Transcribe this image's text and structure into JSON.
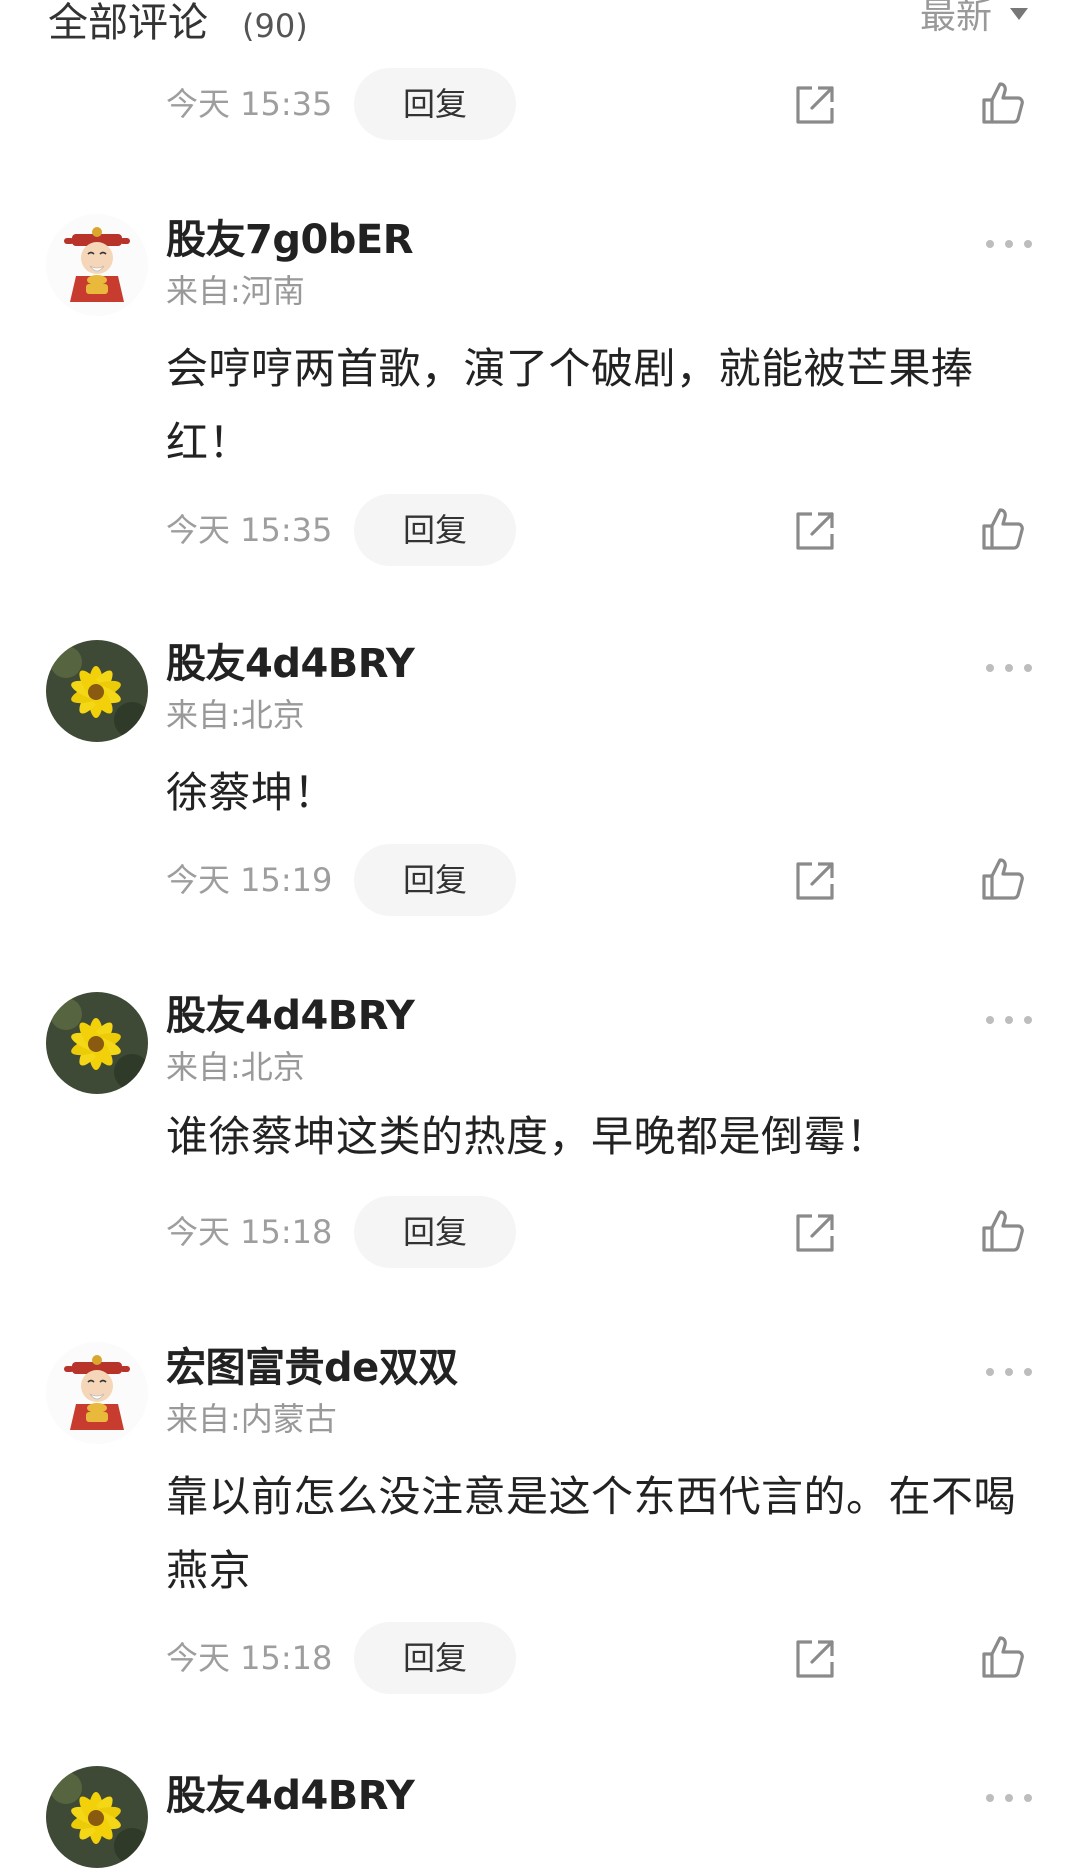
{
  "header": {
    "title": "全部评论",
    "count": "(90)",
    "sort_label": "最新"
  },
  "first_action": {
    "time": "今天 15:35",
    "reply_label": "回复"
  },
  "comments": [
    {
      "username": "股友7g0bER",
      "location": "来自:河南",
      "content": "会哼哼两首歌，演了个破剧，就能被芒果捧红！",
      "time": "今天 15:35",
      "reply_label": "回复",
      "avatar": "god-of-wealth-avatar"
    },
    {
      "username": "股友4d4BRY",
      "location": "来自:北京",
      "content": "徐蔡坤！",
      "time": "今天 15:19",
      "reply_label": "回复",
      "avatar": "yellow-flower-avatar"
    },
    {
      "username": "股友4d4BRY",
      "location": "来自:北京",
      "content": "谁徐蔡坤这类的热度，早晚都是倒霉！",
      "time": "今天 15:18",
      "reply_label": "回复",
      "avatar": "yellow-flower-avatar"
    },
    {
      "username": "宏图富贵de双双",
      "location": "来自:内蒙古",
      "content": "靠以前怎么没注意是这个东西代言的。在不喝燕京",
      "time": "今天 15:18",
      "reply_label": "回复",
      "avatar": "god-of-wealth-avatar"
    },
    {
      "username": "股友4d4BRY",
      "avatar": "yellow-flower-avatar"
    }
  ],
  "colors": {
    "text": "#222222",
    "muted": "#9e9e9e",
    "reply_bg": "#f5f5f5",
    "icon": "#777777"
  }
}
